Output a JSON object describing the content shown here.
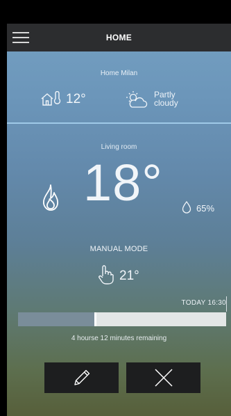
{
  "header": {
    "title": "HOME"
  },
  "home": {
    "name": "Home Milan",
    "outdoor_temp": "12°",
    "weather": "Partly cloudy"
  },
  "room": {
    "name": "Living room",
    "temperature": "18°",
    "humidity": "65%"
  },
  "mode": {
    "label": "MANUAL MODE",
    "setpoint": "21°"
  },
  "schedule": {
    "until": "TODAY 16:30",
    "remaining": "4 hourse 12 minutes remaining",
    "progress_fraction": 0.37
  },
  "icons": {
    "menu": "hamburger-menu-icon",
    "home": "home-thermometer-icon",
    "weather": "partly-cloudy-icon",
    "heating": "flame-icon",
    "humidity": "water-drop-icon",
    "manual": "hand-pointer-icon",
    "edit": "pencil-icon",
    "close": "close-icon"
  }
}
